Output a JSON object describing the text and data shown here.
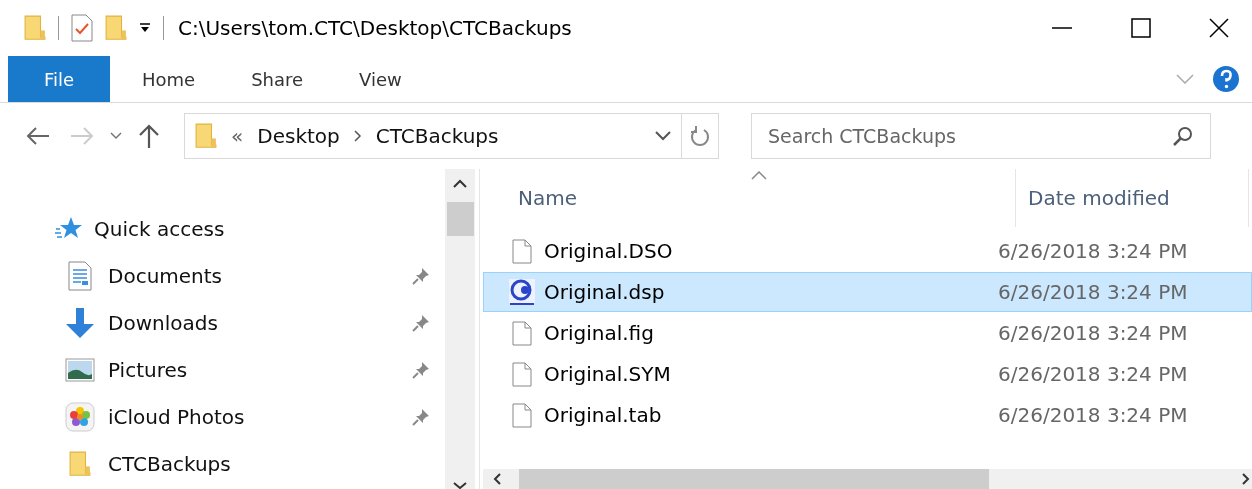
{
  "window": {
    "title": "C:\\Users\\tom.CTC\\Desktop\\CTCBackups"
  },
  "ribbon_tabs": [
    {
      "label": "File",
      "selected": true
    },
    {
      "label": "Home",
      "selected": false
    },
    {
      "label": "Share",
      "selected": false
    },
    {
      "label": "View",
      "selected": false
    }
  ],
  "address_bar": {
    "overflow": "«",
    "crumbs": [
      "Desktop",
      "CTCBackups"
    ]
  },
  "search": {
    "placeholder": "Search CTCBackups"
  },
  "sidebar": {
    "items": [
      {
        "kind": "quick-access",
        "label": "Quick access",
        "pinned": false
      },
      {
        "kind": "documents",
        "label": "Documents",
        "pinned": true
      },
      {
        "kind": "downloads",
        "label": "Downloads",
        "pinned": true
      },
      {
        "kind": "pictures",
        "label": "Pictures",
        "pinned": true
      },
      {
        "kind": "photos",
        "label": "iCloud Photos",
        "pinned": true
      },
      {
        "kind": "folder",
        "label": "CTCBackups",
        "pinned": false
      }
    ]
  },
  "table": {
    "columns": [
      "Name",
      "Date modified"
    ],
    "rows": [
      {
        "kind": "file",
        "name": "Original.DSO",
        "date": "6/26/2018 3:24 PM",
        "selected": false
      },
      {
        "kind": "app",
        "name": "Original.dsp",
        "date": "6/26/2018 3:24 PM",
        "selected": true
      },
      {
        "kind": "file",
        "name": "Original.fig",
        "date": "6/26/2018 3:24 PM",
        "selected": false
      },
      {
        "kind": "file",
        "name": "Original.SYM",
        "date": "6/26/2018 3:24 PM",
        "selected": false
      },
      {
        "kind": "file",
        "name": "Original.tab",
        "date": "6/26/2018 3:24 PM",
        "selected": false
      }
    ]
  }
}
